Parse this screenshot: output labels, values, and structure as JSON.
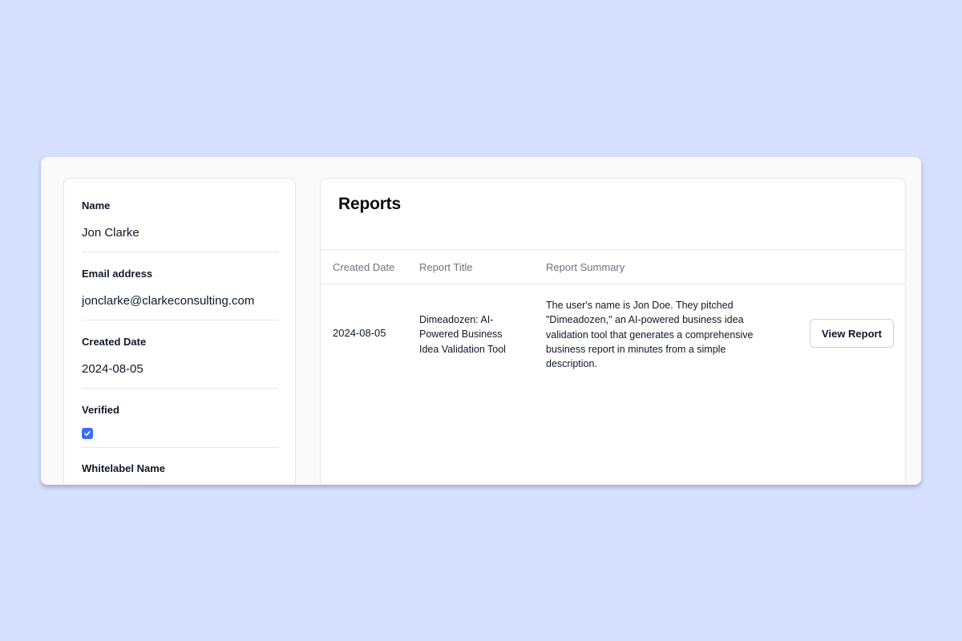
{
  "profile": {
    "name_label": "Name",
    "name_value": "Jon Clarke",
    "email_label": "Email address",
    "email_value": "jonclarke@clarkeconsulting.com",
    "created_label": "Created Date",
    "created_value": "2024-08-05",
    "verified_label": "Verified",
    "verified_checked": true,
    "whitelabel_label": "Whitelabel Name"
  },
  "reports": {
    "title": "Reports",
    "columns": [
      "Created Date",
      "Report Title",
      "Report Summary"
    ],
    "rows": [
      {
        "created_date": "2024-08-05",
        "title": "Dimeadozen: AI-Powered Business Idea Validation Tool",
        "summary": "The user's name is Jon Doe. They pitched \"Dimeadozen,\" an AI-powered business idea validation tool that generates a comprehensive business report in minutes from a simple description.",
        "action_label": "View Report"
      }
    ]
  },
  "colors": {
    "page_background": "#d6e0fe",
    "accent": "#3b6ef5"
  },
  "icons": {
    "verified_checkbox": "check-icon"
  }
}
